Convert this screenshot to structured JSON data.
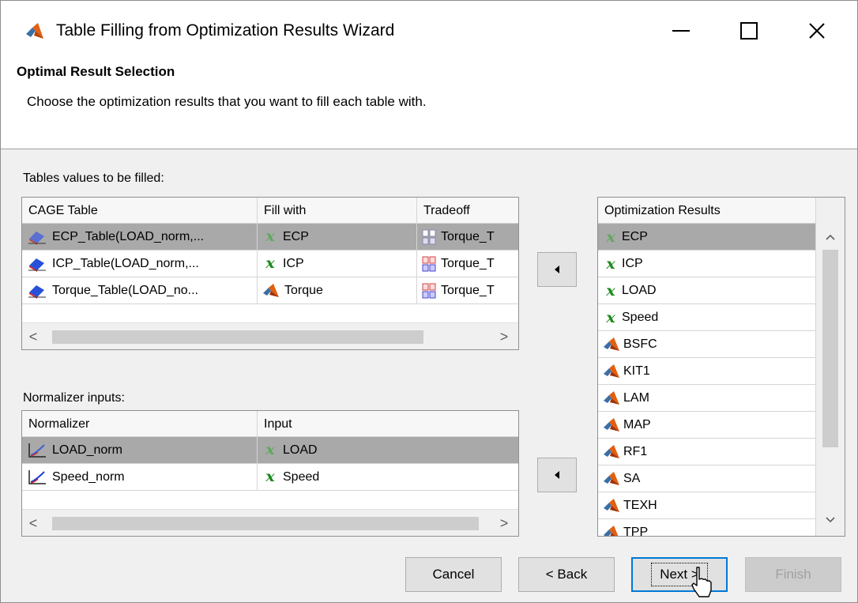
{
  "window": {
    "title": "Table Filling from Optimization Results Wizard",
    "controls": {
      "minimize": "—",
      "maximize": "☐",
      "close": "✕"
    }
  },
  "header": {
    "title": "Optimal Result Selection",
    "description": "Choose the optimization results that you want to fill each table with."
  },
  "tables_section": {
    "label": "Tables values to be filled:",
    "columns": [
      "CAGE Table",
      "Fill with",
      "Tradeoff"
    ],
    "rows": [
      {
        "table": "ECP_Table(LOAD_norm,...",
        "fill_icon": "x-variable-icon",
        "fill": "ECP",
        "tradeoff": "Torque_T",
        "selected": true
      },
      {
        "table": "ICP_Table(LOAD_norm,...",
        "fill_icon": "x-variable-icon",
        "fill": "ICP",
        "tradeoff": "Torque_T",
        "selected": false
      },
      {
        "table": "Torque_Table(LOAD_no...",
        "fill_icon": "matlab-model-icon",
        "fill": "Torque",
        "tradeoff": "Torque_T",
        "selected": false
      }
    ],
    "scroll_left": "<",
    "scroll_right": ">"
  },
  "normalizer_section": {
    "label": "Normalizer inputs:",
    "columns": [
      "Normalizer",
      "Input"
    ],
    "rows": [
      {
        "normalizer": "LOAD_norm",
        "input": "LOAD",
        "selected": true
      },
      {
        "normalizer": "Speed_norm",
        "input": "Speed",
        "selected": false
      }
    ],
    "scroll_left": "<",
    "scroll_right": ">"
  },
  "optimization_results": {
    "header": "Optimization Results",
    "items": [
      {
        "label": "ECP",
        "icon": "x-variable-icon",
        "selected": true
      },
      {
        "label": "ICP",
        "icon": "x-variable-icon",
        "selected": false
      },
      {
        "label": "LOAD",
        "icon": "x-variable-icon",
        "selected": false
      },
      {
        "label": "Speed",
        "icon": "x-variable-icon",
        "selected": false
      },
      {
        "label": "BSFC",
        "icon": "matlab-model-icon",
        "selected": false
      },
      {
        "label": "KIT1",
        "icon": "matlab-model-icon",
        "selected": false
      },
      {
        "label": "LAM",
        "icon": "matlab-model-icon",
        "selected": false
      },
      {
        "label": "MAP",
        "icon": "matlab-model-icon",
        "selected": false
      },
      {
        "label": "RF1",
        "icon": "matlab-model-icon",
        "selected": false
      },
      {
        "label": "SA",
        "icon": "matlab-model-icon",
        "selected": false
      },
      {
        "label": "TEXH",
        "icon": "matlab-model-icon",
        "selected": false
      },
      {
        "label": "TPP",
        "icon": "matlab-model-icon",
        "selected": false
      }
    ]
  },
  "buttons": {
    "cancel": "Cancel",
    "back": "< Back",
    "next": "Next >",
    "finish": "Finish"
  },
  "colors": {
    "selected_row": "#a9a9a9",
    "focus_border": "#0078d7",
    "x_icon": "#1a8a1a"
  }
}
